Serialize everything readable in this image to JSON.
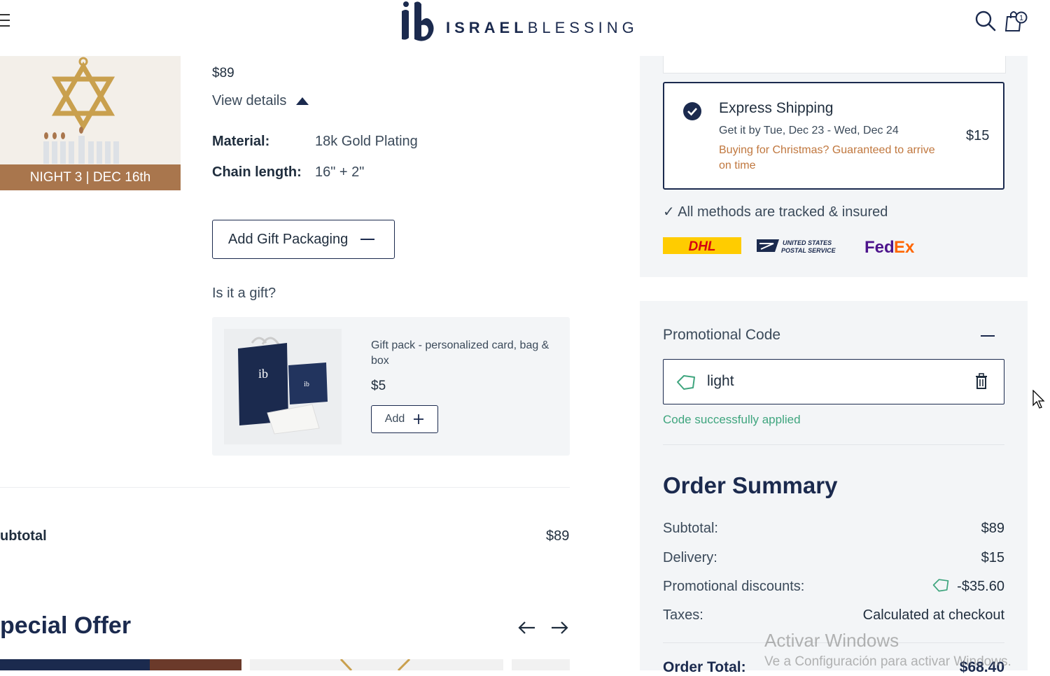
{
  "header": {
    "logo_bold": "ISRAEL",
    "logo_light": "BLESSING",
    "cart_count": "1",
    "icons": [
      "menu-icon",
      "search-icon",
      "cart-icon"
    ]
  },
  "product": {
    "banner": "NIGHT 3 | DEC 16th",
    "price": "$89",
    "view_details": "View details",
    "specs": [
      {
        "label": "Material:",
        "value": "18k Gold Plating"
      },
      {
        "label": "Chain length:",
        "value": "16\" + 2\""
      }
    ]
  },
  "gift": {
    "button_label": "Add Gift Packaging",
    "question": "Is it a gift?",
    "item_name": "Gift pack - personalized card, bag & box",
    "item_price": "$5",
    "add_label": "Add"
  },
  "subtotal": {
    "label": "ubtotal",
    "value": "$89"
  },
  "special_offer": {
    "title": "pecial Offer"
  },
  "shipping": {
    "express_title": "Express Shipping",
    "express_date": "Get it by Tue, Dec 23 - Wed, Dec 24",
    "express_note": "Buying for Christmas? Guaranteed to arrive on time",
    "express_price": "$15",
    "tracked": "✓ All methods are tracked & insured",
    "carriers": {
      "dhl": "DHL",
      "usps_line1": "UNITED STATES",
      "usps_line2": "POSTAL SERVICE",
      "fedex_fed": "Fed",
      "fedex_ex": "Ex"
    }
  },
  "promo": {
    "title": "Promotional Code",
    "code": "light",
    "message": "Code successfully applied"
  },
  "summary": {
    "title": "Order Summary",
    "rows": [
      {
        "label": "Subtotal:",
        "value": "$89"
      },
      {
        "label": "Delivery:",
        "value": "$15"
      },
      {
        "label": "Promotional discounts:",
        "value": "-$35.60"
      },
      {
        "label": "Taxes:",
        "value": "Calculated at checkout"
      }
    ],
    "total_label": "Order Total:",
    "total_value": "$68.40"
  },
  "watermark": {
    "line1": "Activar Windows",
    "line2": "Ve a Configuración para activar Windows."
  },
  "colors": {
    "navy": "#1b2a4e",
    "gold_banner": "#a9764d",
    "success_green": "#3fa57e",
    "note_orange": "#c0773e"
  }
}
